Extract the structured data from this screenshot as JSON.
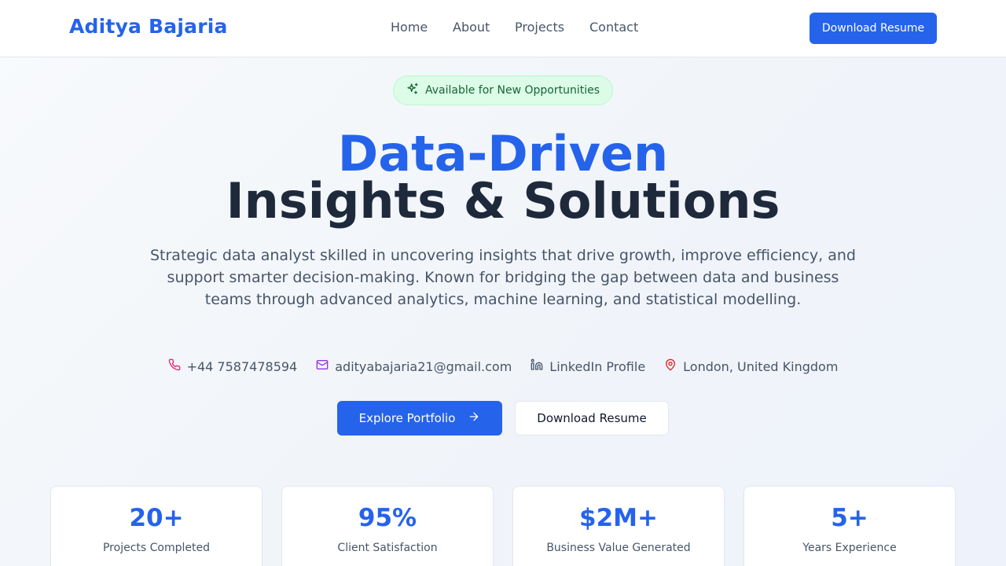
{
  "header": {
    "brand": "Aditya Bajaria",
    "nav": [
      {
        "label": "Home"
      },
      {
        "label": "About"
      },
      {
        "label": "Projects"
      },
      {
        "label": "Contact"
      }
    ],
    "cta_label": "Download Resume"
  },
  "hero": {
    "badge_text": "Available for New Opportunities",
    "badge_icon": "sparkles-icon",
    "title_line1": "Data-Driven",
    "title_line2": "Insights & Solutions",
    "description": "Strategic data analyst skilled in uncovering insights that drive growth, improve efficiency, and support smarter decision-making. Known for bridging the gap between data and business teams through advanced analytics, machine learning, and statistical modelling.",
    "contacts": {
      "phone": "+44 7587478594",
      "email": "adityabajaria21@gmail.com",
      "linkedin": "LinkedIn Profile",
      "location": "London, United Kingdom"
    },
    "primary_button": "Explore Portfolio",
    "secondary_button": "Download Resume"
  },
  "stats": [
    {
      "value": "20+",
      "label": "Projects Completed"
    },
    {
      "value": "95%",
      "label": "Client Satisfaction"
    },
    {
      "value": "$2M+",
      "label": "Business Value Generated"
    },
    {
      "value": "5+",
      "label": "Years Experience"
    }
  ],
  "colors": {
    "accent": "#2563eb",
    "heading": "#1e293b",
    "badge_bg": "#dcfce7",
    "badge_text": "#166534",
    "phone_icon": "#db2777",
    "email_icon": "#9333ea",
    "linkedin_icon": "#475569",
    "location_icon": "#dc2626"
  }
}
